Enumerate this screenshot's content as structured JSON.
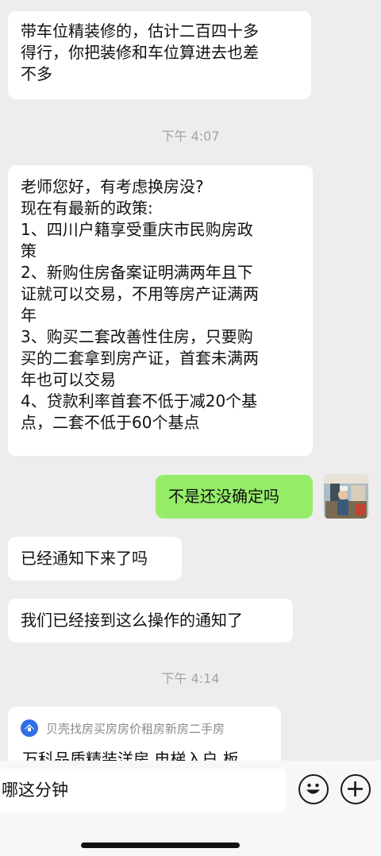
{
  "messages": {
    "m1": "带车位精装修的，估计二百四十多\n得行，你把装修和车位算进去也差\n不多",
    "time1": "下午 4:07",
    "m2": "老师您好，有考虑换房没?\n现在有最新的政策:\n1、四川户籍享受重庆市民购房政\n策\n2、新购住房备案证明满两年且下\n证就可以交易，不用等房产证满两\n年\n3、购买二套改善性住房，只要购\n买的二套拿到房产证，首套未满两\n年也可以交易\n4、贷款利率首套不低于减20个基\n点，二套不低于60个基点",
    "m3": "不是还没确定吗",
    "m4": "已经通知下来了吗",
    "m5": "我们已经接到这么操作的通知了",
    "time2": "下午 4:14"
  },
  "share_card": {
    "source": "贝壳找房买房房价租房新房二手房",
    "title": "万科品质精装洋房 电梯入户 板"
  },
  "input": {
    "text": "哪这分钟"
  },
  "icons": {
    "emoji": "emoji-icon",
    "plus": "plus-icon"
  },
  "colors": {
    "background": "#ededed",
    "my_bubble": "#95ec69",
    "other_bubble": "#ffffff",
    "share_logo": "#2f6ee7"
  }
}
